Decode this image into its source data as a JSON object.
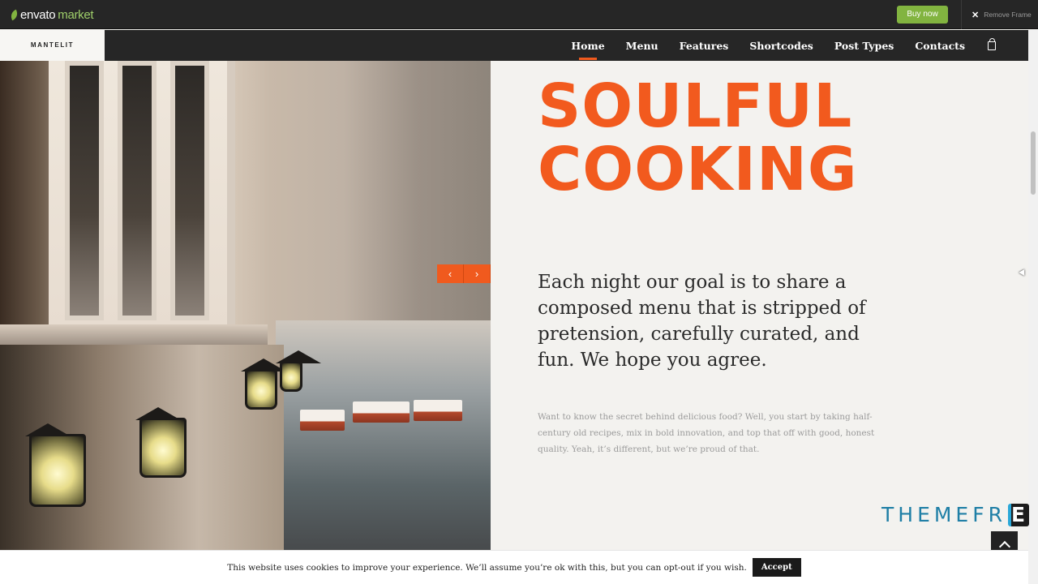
{
  "topbar": {
    "logo_envato": "envato",
    "logo_market": "market",
    "buy_label": "Buy now",
    "remove_label": "Remove Frame"
  },
  "navbar": {
    "brand": "MANTELIT",
    "items": [
      "Home",
      "Menu",
      "Features",
      "Shortcodes",
      "Post Types",
      "Contacts"
    ],
    "active": "Home"
  },
  "hero": {
    "headline_line1": "SOULFUL",
    "headline_line2": "COOKING",
    "lead": "Each night our goal is to share a composed menu that is stripped of pretension, carefully curated, and fun. We hope you agree.",
    "body": "Want to know the secret behind delicious food? Well, you start by taking half-century old recipes, mix in bold innovation, and top that off with good, honest quality. Yeah, it’s different, but we’re proud of that.",
    "prev_arrow": "‹",
    "next_arrow": "›"
  },
  "watermark": {
    "text": "THEMEFR",
    "badge": "E"
  },
  "cookie": {
    "message": "This website uses cookies to improve your experience. We’ll assume you’re ok with this, but you can opt-out if you wish.",
    "accept_label": "Accept"
  },
  "colors": {
    "accent": "#f05a1e",
    "envato_green": "#82b440",
    "dark": "#262626"
  }
}
